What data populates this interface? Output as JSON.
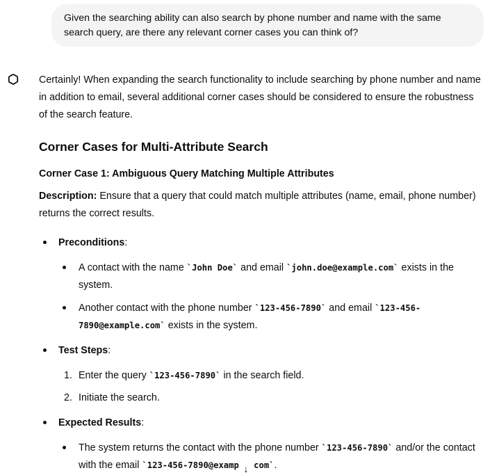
{
  "user_message": {
    "text_line1": "Given the searching ability can also search by phone number and name with the same",
    "text_line2": "search query, are there any relevant corner cases you can think of?"
  },
  "assistant": {
    "avatar_icon": "openai-logo-icon",
    "intro": {
      "line1": "Certainly! When expanding the search functionality to include searching by phone number and name",
      "line2": "in addition to email, several additional corner cases should be considered to ensure the robustness",
      "line3": "of the search feature."
    },
    "heading": "Corner Cases for Multi-Attribute Search",
    "subheading": "Corner Case 1: Ambiguous Query Matching Multiple Attributes",
    "description": {
      "label": "Description:",
      "line1_rest": " Ensure that a query that could match multiple attributes (name, email, phone number)",
      "line2": "returns the correct results."
    },
    "preconditions": {
      "label": "Preconditions",
      "colon": ":",
      "item1": {
        "t1": "A contact with the name ",
        "c1": "`John Doe`",
        "t2": " and email ",
        "c2": "`john.doe@example.com`",
        "t3": " exists in the",
        "line2": "system."
      },
      "item2": {
        "t1": "Another contact with the phone number ",
        "c1": "`123-456-7890`",
        "t2": " and email ",
        "c2a": "`123-456-",
        "c2b": "7890@example.com`",
        "t3": " exists in the system."
      }
    },
    "test_steps": {
      "label": "Test Steps",
      "colon": ":",
      "step1_num": "1.",
      "step1_t1": "Enter the query ",
      "step1_c1": "`123-456-7890`",
      "step1_t2": " in the search field.",
      "step2_num": "2.",
      "step2_text": "Initiate the search."
    },
    "expected": {
      "label": "Expected Results",
      "colon": ":",
      "item1": {
        "t1": "The system returns the contact with the phone number ",
        "c1": "`123-456-7890`",
        "t2": " and/or the contact",
        "l2_t1": "with the email ",
        "l2_c1a": "`123-456-7890@examp",
        "l2_c1b": ".com`",
        "l2_t2": "."
      }
    }
  },
  "scroll_button": {
    "icon": "arrow-down-icon",
    "glyph": "↓"
  }
}
